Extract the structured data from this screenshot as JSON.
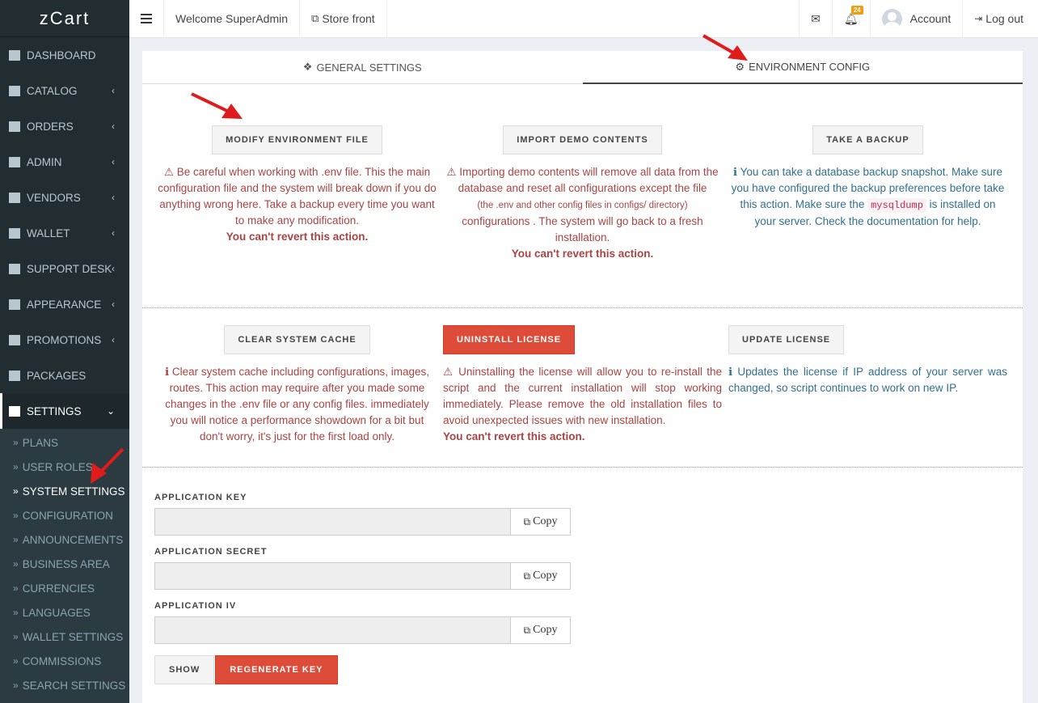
{
  "app": {
    "logo": "zCart"
  },
  "sidebar": {
    "items": [
      {
        "label": "Dashboard",
        "icon": "dashboard-icon",
        "has_children": false
      },
      {
        "label": "Catalog",
        "icon": "tags-icon",
        "has_children": true
      },
      {
        "label": "Orders",
        "icon": "cart-icon",
        "has_children": true
      },
      {
        "label": "Admin",
        "icon": "lock-icon",
        "has_children": true
      },
      {
        "label": "Vendors",
        "icon": "map-marker-icon",
        "has_children": true
      },
      {
        "label": "Wallet",
        "icon": "money-icon",
        "has_children": true
      },
      {
        "label": "Support Desk",
        "icon": "lifebuoy-icon",
        "has_children": true
      },
      {
        "label": "Appearance",
        "icon": "paint-brush-icon",
        "has_children": true
      },
      {
        "label": "Promotions",
        "icon": "bullhorn-icon",
        "has_children": true
      },
      {
        "label": "Packages",
        "icon": "plug-icon",
        "has_children": false
      },
      {
        "label": "Settings",
        "icon": "gears-icon",
        "has_children": true,
        "expanded": true
      }
    ],
    "settings_sub": [
      "Plans",
      "User Roles",
      "System Settings",
      "Configuration",
      "Announcements",
      "Business Area",
      "Currencies",
      "Languages",
      "Wallet Settings",
      "Commissions",
      "Search Settings"
    ]
  },
  "topbar": {
    "welcome": "Welcome SuperAdmin",
    "store_front": "Store front",
    "notification_count": "24",
    "account": "Account",
    "logout": "Log out"
  },
  "tabs": {
    "general": "General Settings",
    "environment": "Environment Config"
  },
  "actions_row1": {
    "modify": {
      "label": "Modify Environment File",
      "text": "Be careful when working with .env file. This the main configuration file and the system will break down if you do anything wrong here. Take a backup every time you want to make any modification.",
      "strong": "You can't revert this action."
    },
    "import": {
      "label": "Import Demo Contents",
      "text_a": "Importing demo contents will remove all data from the database and reset all configurations except the file",
      "text_small": "(the .env and other config files in configs/ directory)",
      "text_b": "configurations . The system will go back to a fresh installation.",
      "strong": "You can't revert this action."
    },
    "backup": {
      "label": "Take a backup",
      "text_a": "You can take a database backup snapshot. Make sure you have configured the backup preferences before take this action. Make sure the",
      "code": "mysqldump",
      "text_b": "is installed on your server. Check the documentation for help."
    }
  },
  "actions_row2": {
    "cache": {
      "label": "Clear system cache",
      "text": "Clear system cache including configurations, images, routes. This action may require after you made some changes in the .env file or any config files. immediately you will notice a performance showdown for a bit but don't worry, it's just for the first load only."
    },
    "uninstall": {
      "label": "Uninstall License",
      "text": "Uninstalling the license will allow you to re-install the script and the current installation will stop working immediately. Please remove the old installation files to avoid unexpected issues with new installation.",
      "strong": "You can't revert this action."
    },
    "update": {
      "label": "Update License",
      "text": "Updates the license if IP address of your server was changed, so script continues to work on new IP."
    }
  },
  "keys": {
    "app_key": "Application Key",
    "app_secret": "Application Secret",
    "app_iv": "Application IV",
    "copy": "Copy",
    "show": "Show",
    "regenerate": "Regenerate Key"
  },
  "colors": {
    "sidebar_bg": "#222d32",
    "danger": "#dd4b39",
    "warning_text": "#a94442",
    "info_text": "#31708f",
    "badge": "#f39c12"
  }
}
